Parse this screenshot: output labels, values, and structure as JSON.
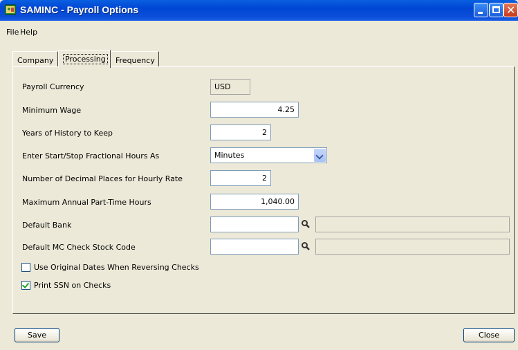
{
  "window": {
    "title": "SAMINC - Payroll Options",
    "icon": "app-icon"
  },
  "menu": [
    {
      "label": "File"
    },
    {
      "label": "Help"
    }
  ],
  "tabs": [
    {
      "label": "Company",
      "active": false
    },
    {
      "label": "Processing",
      "active": true
    },
    {
      "label": "Frequency",
      "active": false
    }
  ],
  "form": {
    "payroll_currency": {
      "label": "Payroll Currency",
      "value": "USD"
    },
    "minimum_wage": {
      "label": "Minimum Wage",
      "value": "4.25"
    },
    "years_history": {
      "label": "Years of History to Keep",
      "value": "2"
    },
    "fractional_hours": {
      "label": "Enter Start/Stop Fractional Hours As",
      "value": "Minutes"
    },
    "decimal_places": {
      "label": "Number of Decimal Places for Hourly Rate",
      "value": "2"
    },
    "max_parttime_hours": {
      "label": "Maximum Annual Part-Time Hours",
      "value": "1,040.00"
    },
    "default_bank": {
      "label": "Default Bank",
      "value": "",
      "description": ""
    },
    "default_check_stock": {
      "label": "Default MC Check Stock Code",
      "value": "",
      "description": ""
    }
  },
  "checkboxes": {
    "use_original_dates": {
      "label": "Use Original Dates When Reversing Checks",
      "checked": false
    },
    "print_ssn": {
      "label": "Print SSN on Checks",
      "checked": true
    }
  },
  "buttons": {
    "save": "Save",
    "close": "Close"
  },
  "colors": {
    "titlebar": "#0046d5",
    "background": "#ece9d8",
    "close_button": "#c6371a",
    "check": "#21a121"
  }
}
